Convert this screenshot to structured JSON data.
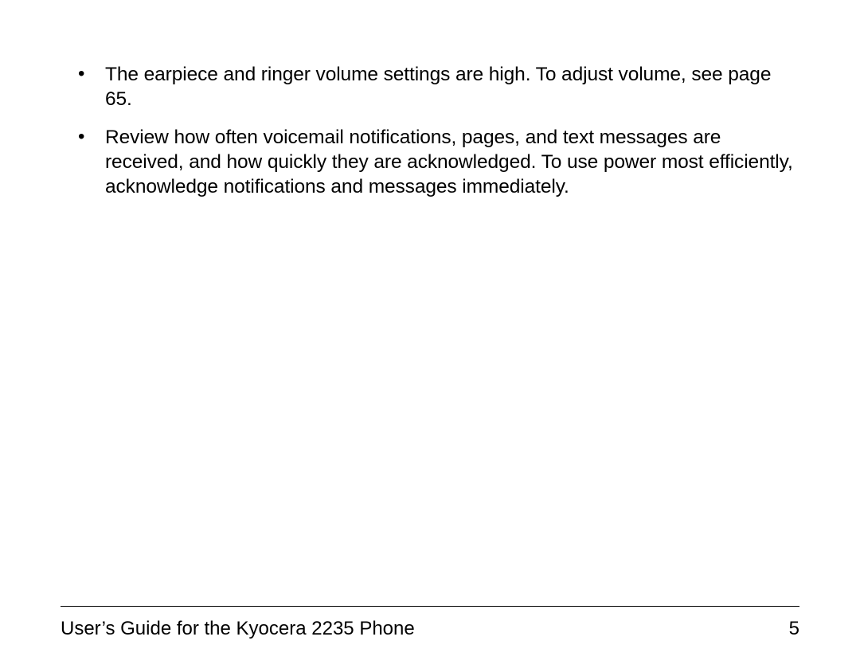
{
  "content": {
    "bullets": [
      "The earpiece and ringer volume settings are high. To adjust volume, see page 65.",
      "Review how often voicemail notifications, pages, and text messages are received, and how quickly they are acknowledged. To use power most efficiently, acknowledge notifications and messages immediately."
    ]
  },
  "footer": {
    "title": "User’s Guide for the Kyocera 2235 Phone",
    "page_number": "5"
  }
}
